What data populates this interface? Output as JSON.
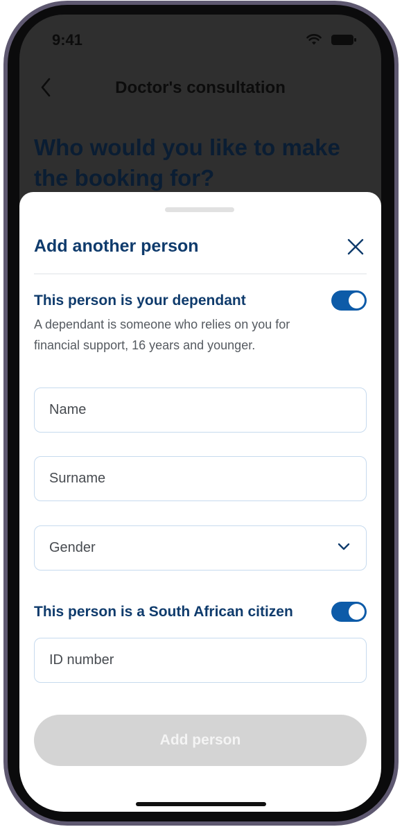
{
  "status_bar": {
    "time": "9:41",
    "icons": [
      "wifi-icon",
      "battery-icon"
    ]
  },
  "background_page": {
    "title": "Doctor's consultation",
    "heading": "Who would you like to make the booking for?",
    "back_icon": "back-chevron-icon"
  },
  "sheet": {
    "title": "Add another person",
    "close_icon": "close-icon",
    "dependant_toggle": {
      "label": "This person is your dependant",
      "enabled": true,
      "description": "A dependant is someone who relies on you for financial support, 16 years and younger."
    },
    "fields": {
      "name": {
        "value": "",
        "placeholder": "Name"
      },
      "surname": {
        "value": "",
        "placeholder": "Surname"
      },
      "gender": {
        "selected": "",
        "placeholder": "Gender"
      }
    },
    "citizen_toggle": {
      "label": "This person is a South African citizen",
      "enabled": true
    },
    "id_field": {
      "value": "",
      "placeholder": "ID number"
    },
    "submit_label": "Add person"
  },
  "colors": {
    "brand_primary": "#0f3b6c",
    "toggle_on": "#0d5ba8",
    "field_border": "#c6daee",
    "disabled_button": "#d4d4d4"
  }
}
